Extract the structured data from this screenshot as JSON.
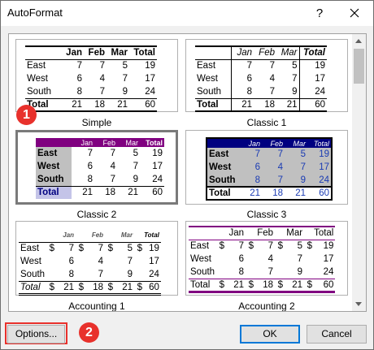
{
  "window": {
    "title": "AutoFormat",
    "help": "?",
    "close_icon": "close-icon"
  },
  "callouts": {
    "one": "1",
    "two": "2"
  },
  "buttons": {
    "options": "Options...",
    "ok": "OK",
    "cancel": "Cancel"
  },
  "months": [
    "Jan",
    "Feb",
    "Mar",
    "Total"
  ],
  "rows": [
    {
      "label": "East",
      "values": [
        "7",
        "7",
        "5",
        "19"
      ]
    },
    {
      "label": "West",
      "values": [
        "6",
        "4",
        "7",
        "17"
      ]
    },
    {
      "label": "South",
      "values": [
        "8",
        "7",
        "9",
        "24"
      ]
    },
    {
      "label": "Total",
      "values": [
        "21",
        "18",
        "21",
        "60"
      ]
    }
  ],
  "formats": [
    {
      "name": "Simple"
    },
    {
      "name": "Classic 1"
    },
    {
      "name": "Classic 2"
    },
    {
      "name": "Classic 3"
    },
    {
      "name": "Accounting 1"
    },
    {
      "name": "Accounting 2"
    }
  ],
  "currency_symbol": "$",
  "colors": {
    "classic2_header": "#800080",
    "classic3_header": "#000080",
    "classic3_text": "#1a3bb3",
    "callout": "#e8312c",
    "accent": "#0078d7"
  }
}
